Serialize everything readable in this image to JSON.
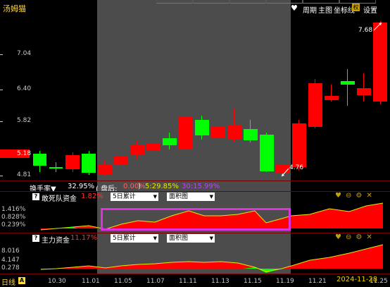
{
  "app": {
    "title": "汤姆猫"
  },
  "toolbar": {
    "period": "周期",
    "chart": "主图",
    "coord": "坐标线",
    "quan": "权",
    "settings": "设置"
  },
  "price_axis": [
    "7.04",
    "6.40",
    "5.82",
    "5.18",
    "4.81"
  ],
  "current_price": "5.18",
  "annotations": {
    "high": "7.68",
    "low": "4.76"
  },
  "info_bar": {
    "turnover_label": "换手率▼",
    "turnover_value": "32.95%",
    "after_hours_label": "( 盘后:",
    "after_hours_value": "0.00%",
    "close_paren": ")",
    "value_a": "5:29.85%",
    "value_b": "30:15.99%"
  },
  "panel1": {
    "title": "敢死队资金",
    "value": "1.82%",
    "mode": "5日累计",
    "chart_type": "面积图",
    "yaxis": [
      "1.416%",
      "0.828%",
      "0.239%"
    ]
  },
  "panel2": {
    "title": "主力资金",
    "value": "11.17%",
    "mode": "5日累计",
    "chart_type": "面积图",
    "yaxis": [
      "8.016",
      "4.147",
      "0.278"
    ]
  },
  "x_axis": [
    "10.30",
    "11.01",
    "11.05",
    "11.07",
    "11.11",
    "11.13",
    "11.15",
    "11.19",
    "11.21",
    "11.25"
  ],
  "period_label": "日线",
  "period_badge": "A",
  "date": "2024-11-28",
  "colors": {
    "up": "#ff0000",
    "down": "#00ff00",
    "accent": "#ffd83a",
    "highlight": "#e030e0"
  }
}
